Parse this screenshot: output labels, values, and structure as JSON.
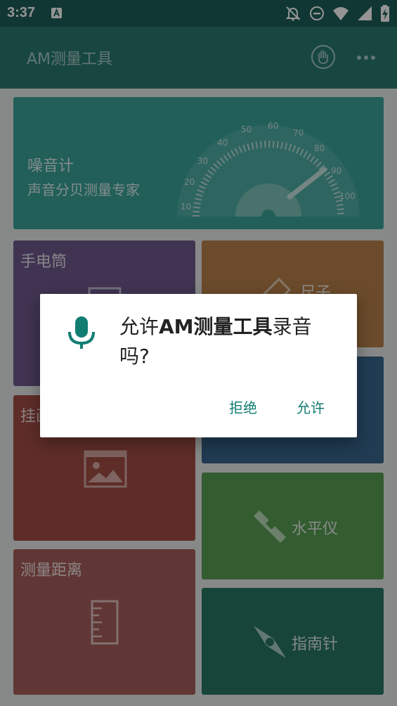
{
  "status_bar": {
    "time": "3:37",
    "icons": [
      "notification-a-icon",
      "bell-off-icon",
      "do-not-disturb-icon",
      "wifi-icon",
      "signal-icon",
      "battery-charging-icon"
    ]
  },
  "app_bar": {
    "title": "AM测量工具",
    "actions": [
      "hand-icon",
      "more-icon"
    ]
  },
  "tiles": {
    "noise": {
      "title": "噪音计",
      "subtitle": "声音分贝测量专家",
      "gauge_ticks": [
        "10",
        "20",
        "30",
        "40",
        "50",
        "60",
        "70",
        "80",
        "90",
        "100"
      ]
    },
    "flashlight": {
      "title": "手电筒"
    },
    "ruler": {
      "title": "尺子"
    },
    "hang": {
      "title": "挂画"
    },
    "level": {
      "title": "水平仪"
    },
    "distance": {
      "title": "测量距离"
    },
    "compass": {
      "title": "指南针"
    }
  },
  "dialog": {
    "message_prefix": "允许",
    "app_name": "AM测量工具",
    "message_suffix": "录音吗?",
    "deny_label": "拒绝",
    "allow_label": "允许",
    "icon": "microphone-icon"
  },
  "colors": {
    "status_bar": "#1d5f58",
    "app_bar": "#2a7a72",
    "accent": "#127d72",
    "noise_tile": "#3ba49a",
    "flashlight_tile": "#6e5b8e",
    "ruler_tile": "#b8824b",
    "hang_tile": "#a44f45",
    "blue_tile": "#38668d",
    "level_tile": "#5a9f55",
    "distance_tile": "#a8605c",
    "compass_tile": "#287762"
  }
}
